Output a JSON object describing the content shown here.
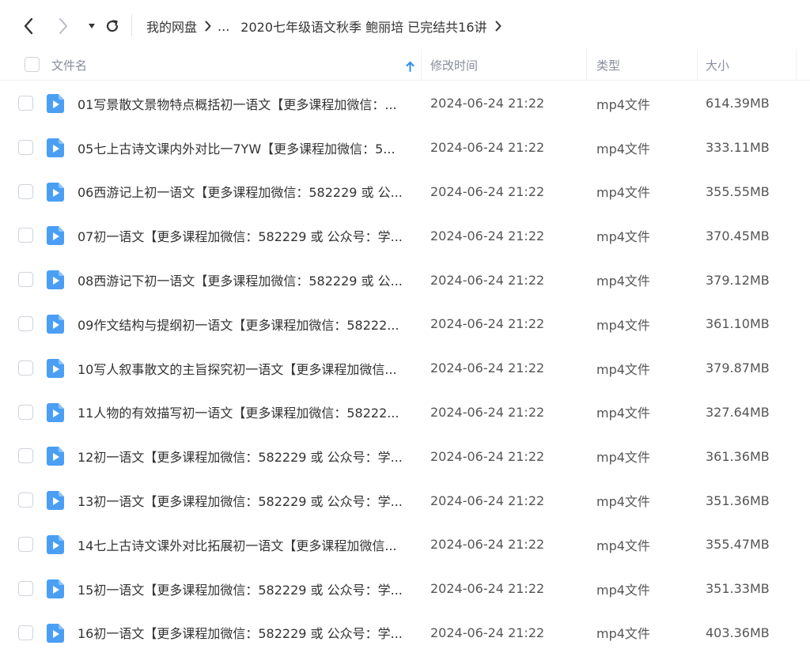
{
  "toolbar": {
    "back_icon": "chevron-left-icon",
    "forward_icon": "chevron-right-icon",
    "dropdown_icon": "caret-down-icon",
    "refresh_icon": "refresh-icon"
  },
  "breadcrumb": {
    "root": "我的网盘",
    "ellipsis": "...",
    "current": "2020七年级语文秋季 鲍丽培 已完结共16讲"
  },
  "columns": {
    "name": "文件名",
    "modified": "修改时间",
    "type": "类型",
    "size": "大小"
  },
  "colors": {
    "accent": "#2f8cf4",
    "file_icon": "#4a9ff5",
    "header_text": "#878c9c",
    "text": "#333333"
  },
  "files": [
    {
      "name": "01写景散文景物特点概括初一语文【更多课程加微信：...",
      "time": "2024-06-24 21:22",
      "type": "mp4文件",
      "size": "614.39MB"
    },
    {
      "name": "05七上古诗文课内外对比一7YW【更多课程加微信：5...",
      "time": "2024-06-24 21:22",
      "type": "mp4文件",
      "size": "333.11MB"
    },
    {
      "name": "06西游记上初一语文【更多课程加微信：582229 或 公...",
      "time": "2024-06-24 21:22",
      "type": "mp4文件",
      "size": "355.55MB"
    },
    {
      "name": "07初一语文【更多课程加微信：582229 或 公众号：学...",
      "time": "2024-06-24 21:22",
      "type": "mp4文件",
      "size": "370.45MB"
    },
    {
      "name": "08西游记下初一语文【更多课程加微信：582229 或 公...",
      "time": "2024-06-24 21:22",
      "type": "mp4文件",
      "size": "379.12MB"
    },
    {
      "name": "09作文结构与提纲初一语文【更多课程加微信：58222...",
      "time": "2024-06-24 21:22",
      "type": "mp4文件",
      "size": "361.10MB"
    },
    {
      "name": "10写人叙事散文的主旨探究初一语文【更多课程加微信...",
      "time": "2024-06-24 21:22",
      "type": "mp4文件",
      "size": "379.87MB"
    },
    {
      "name": "11人物的有效描写初一语文【更多课程加微信：58222...",
      "time": "2024-06-24 21:22",
      "type": "mp4文件",
      "size": "327.64MB"
    },
    {
      "name": "12初一语文【更多课程加微信：582229 或 公众号：学...",
      "time": "2024-06-24 21:22",
      "type": "mp4文件",
      "size": "361.36MB"
    },
    {
      "name": "13初一语文【更多课程加微信：582229 或 公众号：学...",
      "time": "2024-06-24 21:22",
      "type": "mp4文件",
      "size": "351.36MB"
    },
    {
      "name": "14七上古诗文课外对比拓展初一语文【更多课程加微信...",
      "time": "2024-06-24 21:22",
      "type": "mp4文件",
      "size": "355.47MB"
    },
    {
      "name": "15初一语文【更多课程加微信：582229 或 公众号：学...",
      "time": "2024-06-24 21:22",
      "type": "mp4文件",
      "size": "351.33MB"
    },
    {
      "name": "16初一语文【更多课程加微信：582229 或 公众号：学...",
      "time": "2024-06-24 21:22",
      "type": "mp4文件",
      "size": "403.36MB"
    }
  ]
}
